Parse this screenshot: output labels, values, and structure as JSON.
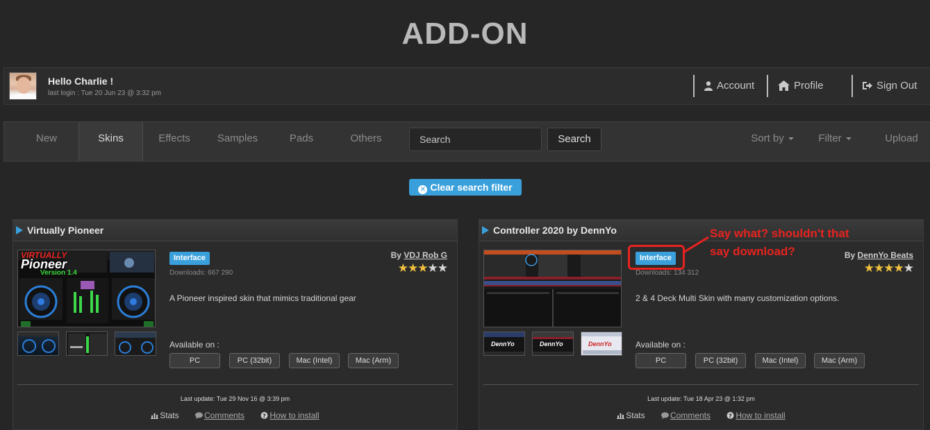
{
  "page": {
    "title": "ADD-ON"
  },
  "user": {
    "greeting": "Hello Charlie !",
    "last_login": "last login : Tue 20 Jun 23 @ 3:32 pm"
  },
  "account_menu": {
    "account": "Account",
    "profile": "Profile",
    "sign_out": "Sign Out"
  },
  "nav": {
    "tabs": [
      {
        "label": "New",
        "active": false
      },
      {
        "label": "Skins",
        "active": true
      },
      {
        "label": "Effects",
        "active": false
      },
      {
        "label": "Samples",
        "active": false
      },
      {
        "label": "Pads",
        "active": false
      },
      {
        "label": "Others",
        "active": false
      }
    ],
    "search_placeholder": "Search",
    "search_button": "Search",
    "sort_by": "Sort by",
    "filter": "Filter",
    "upload": "Upload"
  },
  "clear_filter": "Clear search filter",
  "cards": [
    {
      "title": "Virtually Pioneer",
      "badge": "Interface",
      "downloads": "Downloads: 667 290",
      "by_label": "By",
      "author": "VDJ Rob G",
      "rating": 3,
      "description": "A Pioneer inspired skin that mimics traditional gear",
      "available_label": "Available on :",
      "platforms": [
        "PC",
        "PC (32bit)",
        "Mac (Intel)",
        "Mac (Arm)"
      ],
      "last_update": "Last update: Tue 29 Nov 16 @ 3:39 pm",
      "thumb_text": {
        "line1": "VIRTUALLY",
        "line2": "Pioneer",
        "line3": "Version 1.4"
      },
      "links": {
        "stats": "Stats",
        "comments": "Comments",
        "how_to_install": "How to install"
      }
    },
    {
      "title": "Controller 2020 by DennYo",
      "badge": "Interface",
      "downloads": "Downloads: 134 312",
      "by_label": "By",
      "author": "DennYo Beats",
      "rating": 4,
      "description": "2 & 4 Deck Multi Skin with many customization options.",
      "available_label": "Available on :",
      "platforms": [
        "PC",
        "PC (32bit)",
        "Mac (Intel)",
        "Mac (Arm)"
      ],
      "last_update": "Last update: Tue 18 Apr 23 @ 1:32 pm",
      "thumb_text": {
        "logo": "DennYo"
      },
      "links": {
        "stats": "Stats",
        "comments": "Comments",
        "how_to_install": "How to install"
      }
    }
  ],
  "annotation": {
    "line1": "Say what? shouldn't that",
    "line2": "say download?",
    "color": "#e8231f"
  },
  "colors": {
    "accent": "#3aa0dc",
    "background": "#262626",
    "star": "#f0c040"
  }
}
